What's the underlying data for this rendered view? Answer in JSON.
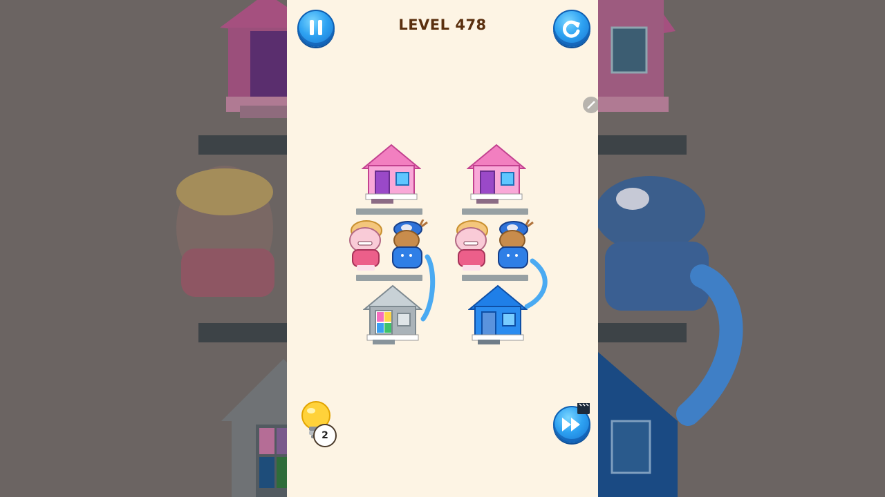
{
  "level": {
    "title": "LEVEL 478"
  },
  "hint": {
    "count": "2"
  },
  "colors": {
    "pink": "#f07bbf",
    "blue": "#1f86ee",
    "gray": "#a8b0b5",
    "bg": "#fdf4e4",
    "title": "#5a2f0e"
  },
  "icons": [
    "pause-icon",
    "restart-icon",
    "edit-icon",
    "lightbulb-icon",
    "skip-forward-icon",
    "video-ad-icon"
  ]
}
